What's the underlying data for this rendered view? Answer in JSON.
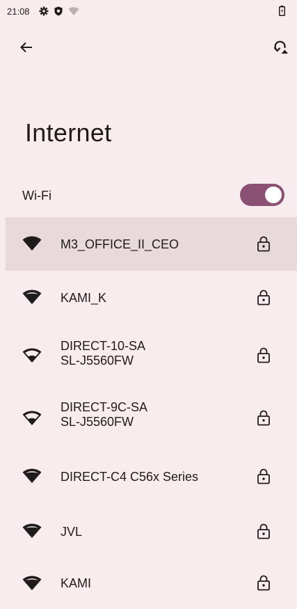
{
  "status_bar": {
    "time": "21:08"
  },
  "title": "Internet",
  "wifi": {
    "label": "Wi-Fi",
    "enabled": true
  },
  "networks": [
    {
      "name_line1": "M3_OFFICE_II_CEO",
      "name_line2": "",
      "secured": true,
      "signal": "full",
      "selected": true
    },
    {
      "name_line1": "KAMI_K",
      "name_line2": "",
      "secured": true,
      "signal": "strong"
    },
    {
      "name_line1": "DIRECT-10-SA",
      "name_line2": "SL-J5560FW",
      "secured": true,
      "signal": "medium"
    },
    {
      "name_line1": "DIRECT-9C-SA",
      "name_line2": "SL-J5560FW",
      "secured": true,
      "signal": "medium"
    },
    {
      "name_line1": "DIRECT-C4 C56x Series",
      "name_line2": "",
      "secured": true,
      "signal": "strong"
    },
    {
      "name_line1": "JVL",
      "name_line2": "",
      "secured": true,
      "signal": "strong"
    },
    {
      "name_line1": "KAMI",
      "name_line2": "",
      "secured": true,
      "signal": "strong"
    }
  ],
  "icons": {
    "back": "arrow-left-icon",
    "restart": "restart-network-icon",
    "settings": "gear-icon",
    "shield": "shield-icon",
    "wifi_status": "wifi-question-icon",
    "battery": "battery-charging-icon",
    "lock": "lock-icon"
  },
  "colors": {
    "background": "#f9ecee",
    "accent": "#8b5074",
    "selected_row": "#e8dadb",
    "text": "#1f1a1c"
  }
}
